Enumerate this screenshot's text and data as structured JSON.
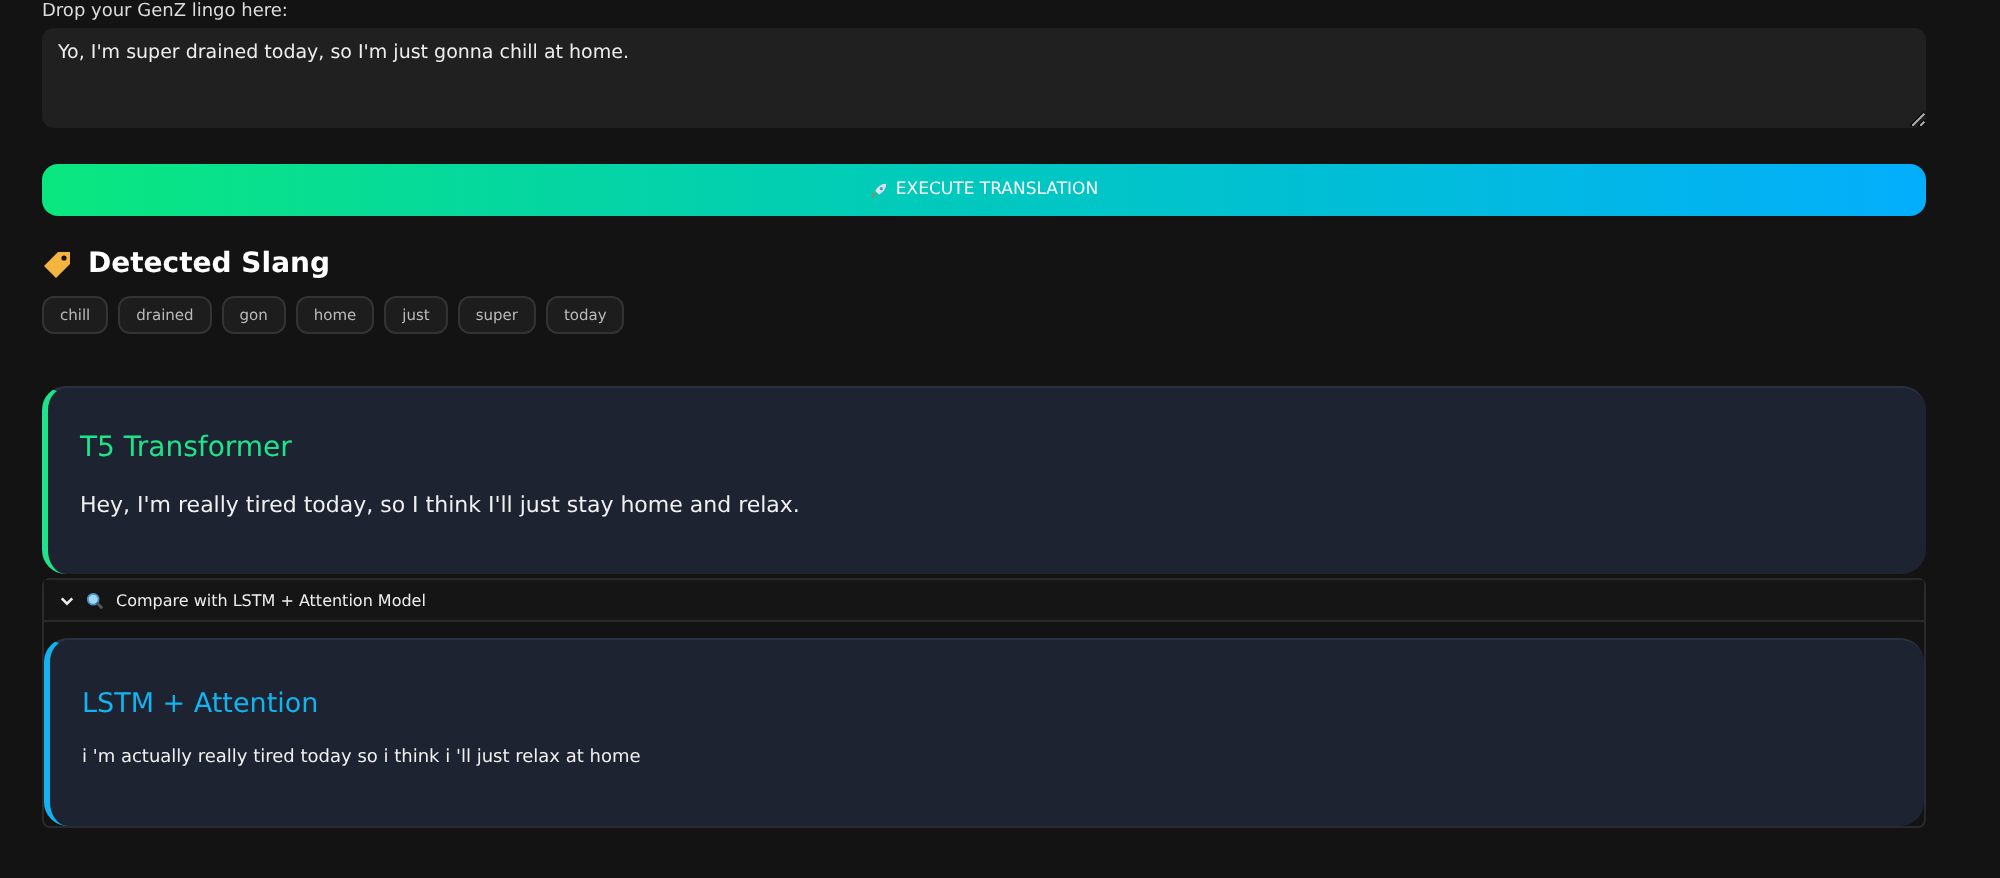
{
  "input": {
    "label": "Drop your GenZ lingo here:",
    "value": "Yo, I'm super drained today, so I'm just gonna chill at home."
  },
  "execute_button": {
    "label": "EXECUTE TRANSLATION"
  },
  "slang": {
    "heading": "Detected Slang",
    "chips": [
      "chill",
      "drained",
      "gon",
      "home",
      "just",
      "super",
      "today"
    ]
  },
  "primary_result": {
    "title": "T5 Transformer",
    "text": "Hey, I'm really tired today, so I think I'll just stay home and relax.",
    "color": "#1ee38a"
  },
  "compare": {
    "label": "Compare with LSTM + Attention Model",
    "expanded": true,
    "result": {
      "title": "LSTM + Attention",
      "text": "i 'm actually really tired today so i think i 'll just relax at home",
      "color": "#12b3f0"
    }
  }
}
